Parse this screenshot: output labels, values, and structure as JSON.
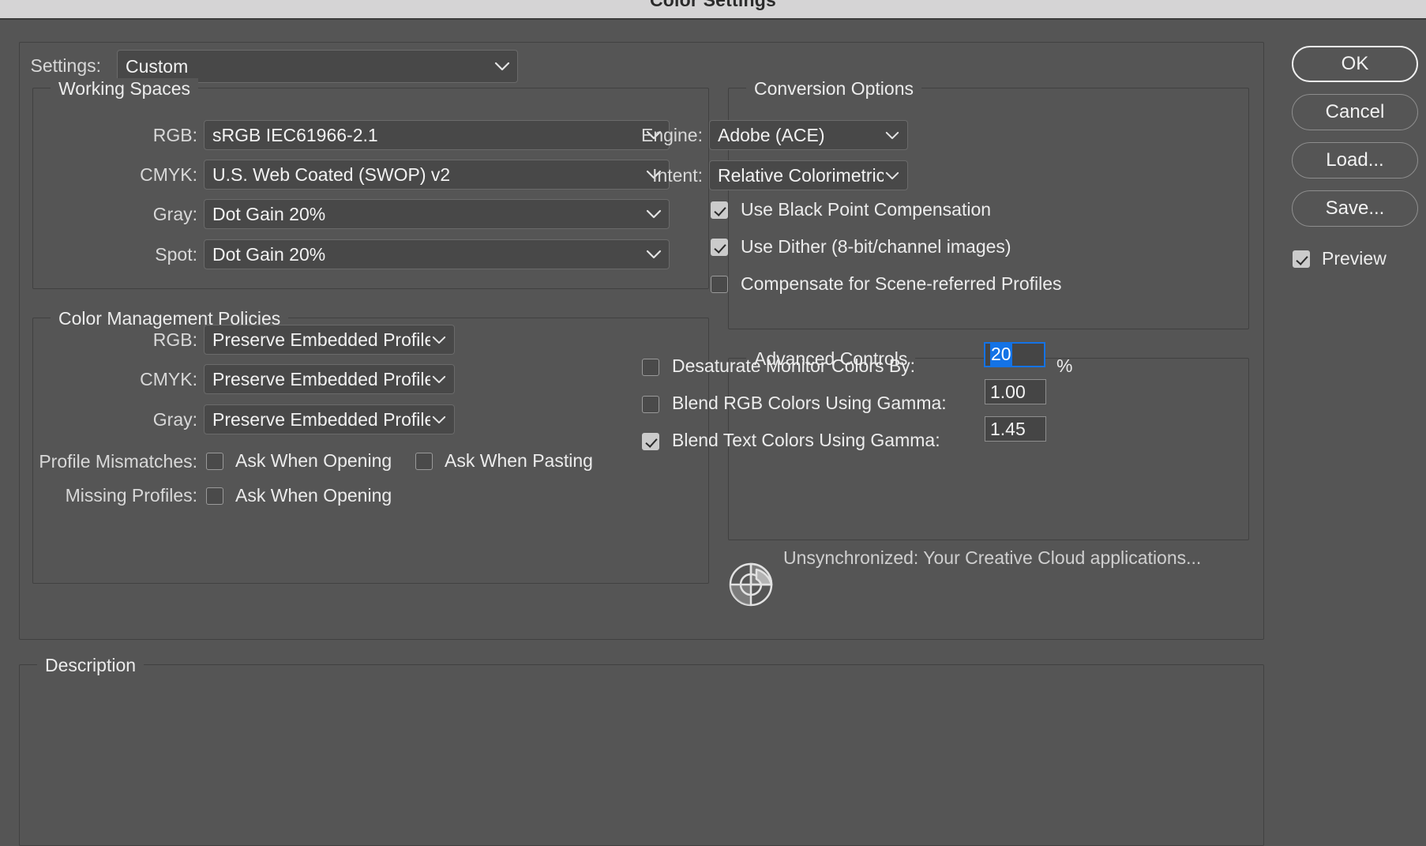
{
  "window": {
    "title": "Color Settings"
  },
  "settings_row": {
    "label": "Settings:",
    "value": "Custom",
    "chevron_icon": "chevron-down-icon"
  },
  "working_spaces": {
    "legend": "Working Spaces",
    "rows": [
      {
        "label": "RGB:",
        "value": "sRGB IEC61966-2.1"
      },
      {
        "label": "CMYK:",
        "value": "U.S. Web Coated (SWOP) v2"
      },
      {
        "label": "Gray:",
        "value": "Dot Gain 20%"
      },
      {
        "label": "Spot:",
        "value": "Dot Gain 20%"
      }
    ]
  },
  "color_management_policies": {
    "legend": "Color Management Policies",
    "rows": [
      {
        "label": "RGB:",
        "value": "Preserve Embedded Profiles"
      },
      {
        "label": "CMYK:",
        "value": "Preserve Embedded Profiles"
      },
      {
        "label": "Gray:",
        "value": "Preserve Embedded Profiles"
      }
    ],
    "profile_mismatches": {
      "label": "Profile Mismatches:",
      "ask_when_opening": {
        "label": "Ask When Opening",
        "checked": false
      },
      "ask_when_pasting": {
        "label": "Ask When Pasting",
        "checked": false
      }
    },
    "missing_profiles": {
      "label": "Missing Profiles:",
      "ask_when_opening": {
        "label": "Ask When Opening",
        "checked": false
      }
    }
  },
  "conversion_options": {
    "legend": "Conversion Options",
    "engine": {
      "label": "Engine:",
      "value": "Adobe (ACE)"
    },
    "intent": {
      "label": "Intent:",
      "value": "Relative Colorimetric"
    },
    "checkboxes": [
      {
        "label": "Use Black Point Compensation",
        "checked": true
      },
      {
        "label": "Use Dither (8-bit/channel images)",
        "checked": true
      },
      {
        "label": "Compensate for Scene-referred Profiles",
        "checked": false
      }
    ]
  },
  "advanced_controls": {
    "legend": "Advanced Controls",
    "desaturate": {
      "label": "Desaturate Monitor Colors By:",
      "checked": false,
      "value": "20",
      "unit": "%",
      "focused": true,
      "selected": true
    },
    "blend_rgb": {
      "label": "Blend RGB Colors Using Gamma:",
      "checked": false,
      "value": "1.00"
    },
    "blend_text": {
      "label": "Blend Text Colors Using Gamma:",
      "checked": true,
      "value": "1.45"
    }
  },
  "sync_status": {
    "icon": "color-sync-pie-icon",
    "message": "Unsynchronized: Your Creative Cloud applications..."
  },
  "description": {
    "legend": "Description",
    "text": ""
  },
  "buttons": {
    "ok": "OK",
    "cancel": "Cancel",
    "load": "Load...",
    "save": "Save...",
    "preview": {
      "label": "Preview",
      "checked": true
    }
  },
  "colors": {
    "dialog_bg": "#555555",
    "titlebar_bg": "#d5d4d5",
    "field_bg": "#484848",
    "accent_blue": "#1473e6",
    "checkbox_on": "#cbcbcb"
  }
}
